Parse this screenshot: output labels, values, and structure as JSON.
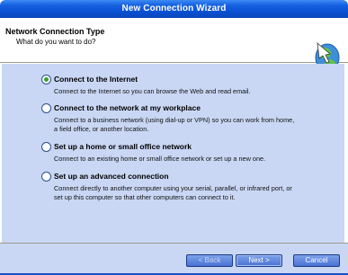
{
  "window": {
    "title": "New Connection Wizard"
  },
  "header": {
    "title": "Network Connection Type",
    "subtitle": "What do you want to do?",
    "icon": "wizard-arrow-icon"
  },
  "options": [
    {
      "label": "Connect to the Internet",
      "selected": true,
      "description": [
        "Connect to the Internet so you can browse the Web and read email."
      ]
    },
    {
      "label": "Connect to the network at my workplace",
      "selected": false,
      "description": [
        "Connect to a business network (using dial-up or VPN) so you can work from home,",
        "a field office, or another location."
      ]
    },
    {
      "label": "Set up a home or small office network",
      "selected": false,
      "description": [
        "Connect to an existing home or small office network or set up a new one."
      ]
    },
    {
      "label": "Set up an advanced connection",
      "selected": false,
      "description": [
        "Connect directly to another computer using your serial, parallel, or infrared port, or",
        "set up this computer so that other computers can connect to it."
      ]
    }
  ],
  "buttons": {
    "back": "< Back",
    "next": "Next >",
    "cancel": "Cancel"
  },
  "colors": {
    "title_bar": "#0a4fd1",
    "panel": "#c9d7f4",
    "radio_dot": "#3a9d2a"
  }
}
